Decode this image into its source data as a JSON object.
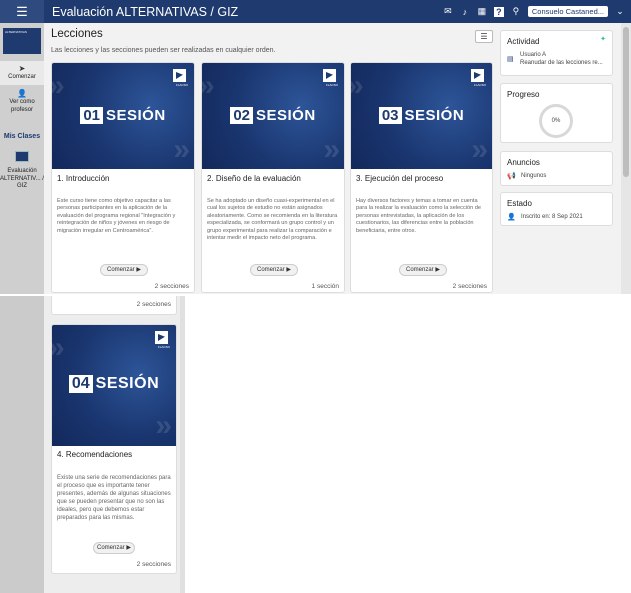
{
  "app": {
    "title": "Evaluación ALTERNATIVAS / GIZ",
    "menu_icon": "hamburger-icon",
    "user_name": "Consuelo Castaned..."
  },
  "sidebar": {
    "thumb_text": "ALTERNATIVAS",
    "items": [
      {
        "label": "Comenzar",
        "icon": "paper-plane-icon"
      },
      {
        "label": "Ver como profesor",
        "icon": "person-icon"
      }
    ],
    "my_classes_heading": "Mis Clases",
    "class_label": "Evaluación ALTERNATIV... / GIZ"
  },
  "main": {
    "title": "Lecciones",
    "subtitle": "Las lecciones y las secciones pueden ser realizadas en cualquier orden."
  },
  "session_word": "SESIÓN",
  "logo_text": "FLACSO",
  "lessons": [
    {
      "number": "01",
      "title": "1. Introducción",
      "description": "Este curso tiene como objetivo capacitar a las personas participantes en la aplicación de la evaluación del programa regional \"Integración y reintegración de niños y jóvenes en riesgo de migración irregular en Centroamérica\".",
      "button": "Comenzar",
      "sections": "2 secciones"
    },
    {
      "number": "02",
      "title": "2. Diseño de la evaluación",
      "description": "Se ha adoptado un diseño cuasi-experimental en el cual los sujetos de estudio no están asignados aleatoriamente. Como se recomienda en la literatura especializada, se conformará un grupo control y un grupo experimental para realizar la comparación e intentar medir el impacto neto del programa.",
      "button": "Comenzar",
      "sections": "1 sección"
    },
    {
      "number": "03",
      "title": "3. Ejecución del proceso",
      "description": "Hay diversos factores y temas a tomar en cuenta para la realizar la evaluación como la selección de personas entrevistadas, la aplicación de los cuestionarios, las diferencias entre la población beneficiaria, entre otros.",
      "button": "Comenzar",
      "sections": "2 secciones"
    },
    {
      "number": "04",
      "title": "4. Recomendaciones",
      "description": "Existe una serie de recomendaciones para el proceso que es importante tener presentes, además de algunas situaciones que se pueden presentar que no son las ideales, pero que debemos estar preparados para las mismas.",
      "button": "Comenzar",
      "sections": "2 secciones"
    }
  ],
  "previous_card_sections": "2 secciones",
  "right_panels": {
    "activity": {
      "title": "Actividad",
      "user": "Usuario A",
      "detail": "Reanudar de las lecciones re..."
    },
    "progress": {
      "title": "Progreso",
      "value": "0%"
    },
    "announcements": {
      "title": "Anuncios",
      "value": "Ningunos"
    },
    "status": {
      "title": "Estado",
      "value": "Inscrito en: 8 Sep 2021"
    }
  },
  "colors": {
    "navy": "#1e3a6e",
    "accent_green": "#2bbf8a"
  }
}
